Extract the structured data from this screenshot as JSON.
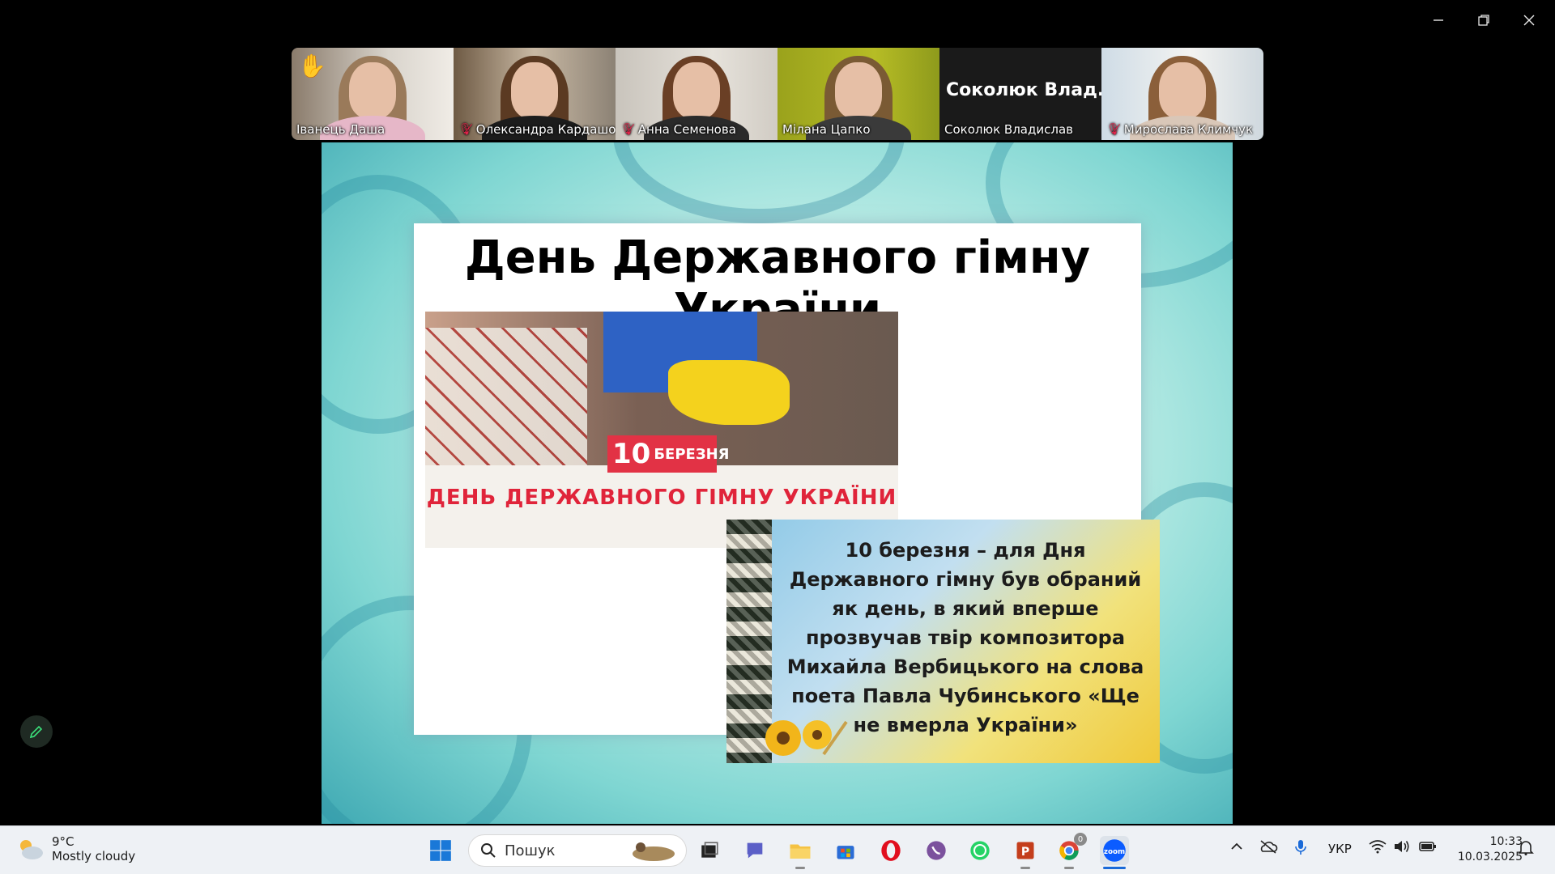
{
  "window": {
    "controls": [
      "minimize-icon",
      "restore-icon",
      "close-icon"
    ]
  },
  "gallery": {
    "participants": [
      {
        "name": "Іванець Даша",
        "muted": false,
        "hand_raised": true,
        "hand": "✋"
      },
      {
        "name": "Олександра Кардашо...",
        "muted": true
      },
      {
        "name": "Анна Семенова",
        "muted": true
      },
      {
        "name": "Мілана Цапко",
        "muted": false,
        "active": true
      },
      {
        "name": "Соколюк Владислав",
        "muted": false,
        "display_name": "Соколюк  Влад..."
      },
      {
        "name": "Мирослава Климчук",
        "muted": true
      }
    ]
  },
  "slide": {
    "title": "День Державного гімну України",
    "image1": {
      "badge_number": "10",
      "badge_text": "БЕРЕЗНЯ",
      "caption": "ДЕНЬ ДЕРЖАВНОГО ГІМНУ УКРАЇНИ"
    },
    "image2": {
      "text": "10 березня – для Дня Державного гімну був обраний як день, в який вперше прозвучав твір композитора Михайла Вербицького на слова поета Павла Чубинського «Ще не вмерла України»"
    }
  },
  "taskbar": {
    "weather": {
      "temp": "9°C",
      "condition": "Mostly cloudy"
    },
    "search_placeholder": "Пошук",
    "language": "УКР",
    "time": "10:33",
    "date": "10.03.2025",
    "chrome_badge": "0"
  },
  "colors": {
    "active_speaker": "#2ee57a",
    "muted_mic": "#e0244a",
    "caption_red": "#e0243a"
  }
}
